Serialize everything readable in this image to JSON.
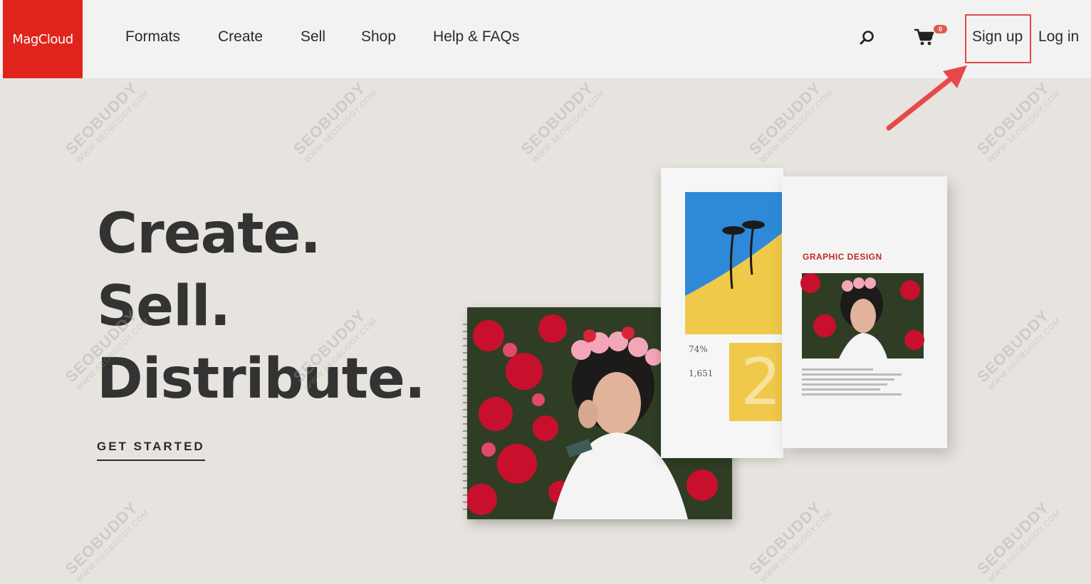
{
  "header": {
    "logo_text": "MagCloud",
    "nav": [
      {
        "label": "Formats"
      },
      {
        "label": "Create"
      },
      {
        "label": "Sell"
      },
      {
        "label": "Shop"
      },
      {
        "label": "Help & FAQs"
      }
    ],
    "search_icon": "search-icon",
    "cart_icon": "cart-icon",
    "cart_count": "0",
    "signup_label": "Sign up",
    "login_label": "Log in"
  },
  "hero": {
    "line1": "Create.",
    "line2": "Sell.",
    "line3": "Distribute.",
    "cta_label": "GET STARTED"
  },
  "magazine": {
    "heading": "GRAPHIC DESIGN",
    "stat1": "74%",
    "stat2": "1,651"
  },
  "watermark": {
    "brand": "SEOBUDDY",
    "url": "WWW.SEOBUDDY.COM"
  },
  "colors": {
    "brand_red": "#e0241c",
    "hero_bg": "#e7e3de",
    "header_bg": "#f2f2f2",
    "annotation_red": "#e8484a"
  }
}
